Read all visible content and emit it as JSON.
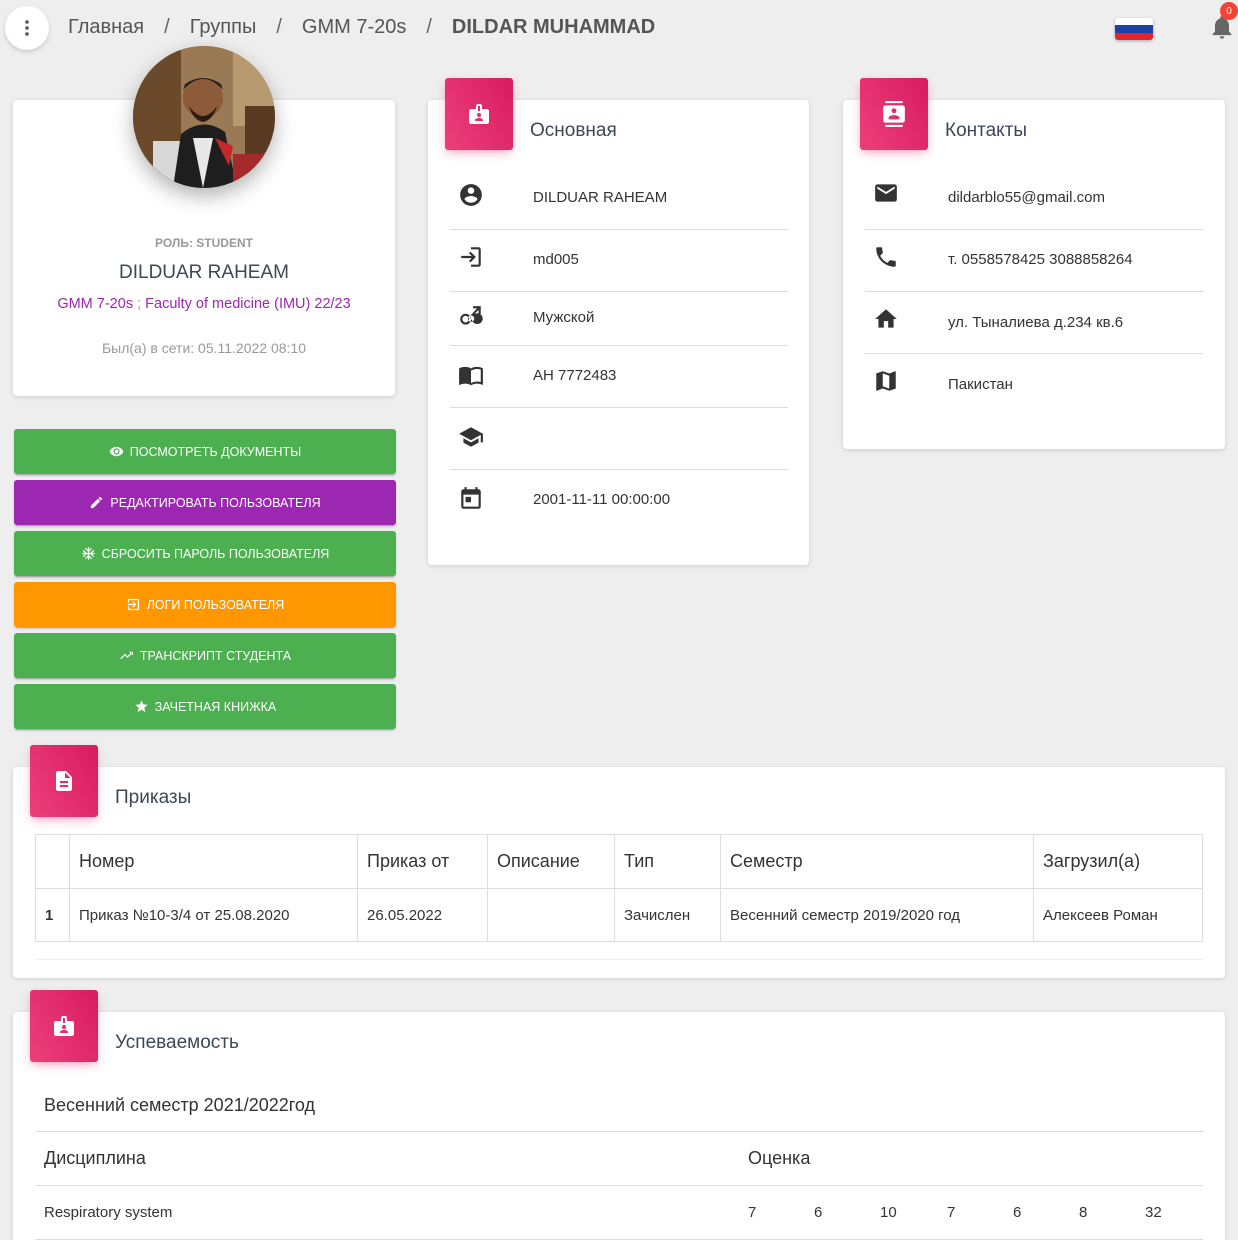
{
  "breadcrumb": {
    "items": [
      "Главная",
      "Группы",
      "GMM 7-20s"
    ],
    "separator": "/",
    "active": "DILDAR MUHAMMAD"
  },
  "notifications": {
    "count": "0",
    "icon": "bell-icon"
  },
  "language_flag": {
    "colors": [
      "#ffffff",
      "#1c3fa8",
      "#e3242b"
    ]
  },
  "profile": {
    "role": "РОЛЬ: STUDENT",
    "name": "DILDUAR RAHEAM",
    "group": "GMM 7-20s",
    "group_separator": ";",
    "faculty": "Faculty of medicine (IMU) 22/23",
    "last_online": "Был(а) в сети: 05.11.2022 08:10"
  },
  "actions": [
    {
      "label": "ПОСМОТРЕТЬ ДОКУМЕНТЫ",
      "icon": "eye-icon",
      "color": "#4caf50"
    },
    {
      "label": "РЕДАКТИРОВАТЬ ПОЛЬЗОВАТЕЛЯ",
      "icon": "pencil-icon",
      "color": "#9c27b0"
    },
    {
      "label": "СБРОСИТЬ ПАРОЛЬ ПОЛЬЗОВАТЕЛЯ",
      "icon": "snowflake-icon",
      "color": "#4caf50"
    },
    {
      "label": "ЛОГИ ПОЛЬЗОВАТЕЛЯ",
      "icon": "login-icon",
      "color": "#ff9800"
    },
    {
      "label": "ТРАНСКРИПТ СТУДЕНТА",
      "icon": "trending-up-icon",
      "color": "#4caf50"
    },
    {
      "label": "ЗАЧЕТНАЯ КНИЖКА",
      "icon": "star-icon",
      "color": "#4caf50"
    }
  ],
  "basic": {
    "title": "Основная",
    "rows": [
      {
        "icon": "account-circle-icon",
        "value": "DILDUAR RAHEAM"
      },
      {
        "icon": "login-icon",
        "value": "md005"
      },
      {
        "icon": "gender-icon",
        "value": "Мужской"
      },
      {
        "icon": "book-icon",
        "value": "AH 7772483"
      },
      {
        "icon": "school-icon",
        "value": ""
      },
      {
        "icon": "calendar-icon",
        "value": "2001-11-11 00:00:00"
      }
    ]
  },
  "contacts": {
    "title": "Контакты",
    "rows": [
      {
        "icon": "mail-icon",
        "value": "dildarblo55@gmail.com"
      },
      {
        "icon": "phone-icon",
        "value": "т. 0558578425 3088858264"
      },
      {
        "icon": "home-icon",
        "value": "ул. Тыналиева д.234 кв.6"
      },
      {
        "icon": "map-icon",
        "value": "Пакистан"
      }
    ]
  },
  "orders": {
    "title": "Приказы",
    "columns": [
      "",
      "Номер",
      "Приказ от",
      "Описание",
      "Тип",
      "Семестр",
      "Загрузил(а)"
    ],
    "rows": [
      [
        "1",
        "Приказ №10-3/4 от 25.08.2020",
        "26.05.2022",
        "",
        "Зачислен",
        "Весенний семестр 2019/2020 год",
        "Алексеев Роман"
      ]
    ]
  },
  "performance": {
    "title": "Успеваемость",
    "semester": "Весенний семестр 2021/2022год",
    "col_discipline": "Дисциплина",
    "col_grade": "Оценка",
    "rows": [
      {
        "discipline": "Respiratory system",
        "grades": [
          "7",
          "6",
          "10",
          "7",
          "6",
          "8",
          "32"
        ]
      }
    ]
  }
}
